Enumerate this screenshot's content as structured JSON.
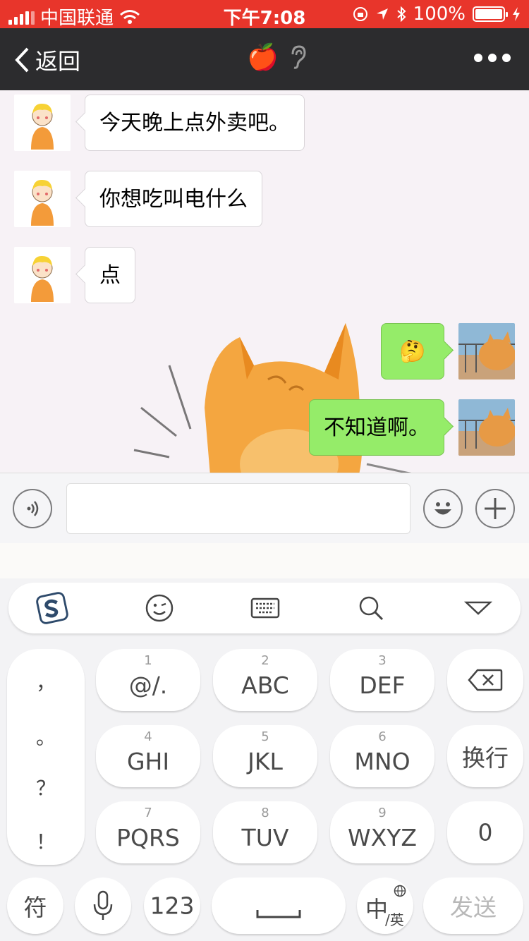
{
  "status_bar": {
    "carrier": "中国联通",
    "time": "下午7:08",
    "battery": "100%",
    "color": "#e8352b"
  },
  "nav": {
    "back_label": "返回",
    "title_emoji": "🍎"
  },
  "messages": [
    {
      "side": "in",
      "text": "今天晚上点外卖吧。"
    },
    {
      "side": "in",
      "text": "你想吃叫电什么"
    },
    {
      "side": "in",
      "text": "点"
    },
    {
      "side": "out",
      "text": "🤔"
    },
    {
      "side": "out",
      "text": "不知道啊。"
    }
  ],
  "input": {
    "placeholder": "",
    "voice_icon": "voice-icon",
    "emoji_icon": "emoji-icon",
    "plus_icon": "plus-icon"
  },
  "keyboard": {
    "toolbar": [
      "sogou-logo-icon",
      "wink-emoji-icon",
      "keyboard-icon",
      "search-icon",
      "collapse-icon"
    ],
    "punctuation": [
      "，",
      "。",
      "？",
      "！"
    ],
    "keys": [
      {
        "num": "1",
        "label": "@/."
      },
      {
        "num": "2",
        "label": "ABC"
      },
      {
        "num": "3",
        "label": "DEF"
      },
      {
        "num": "4",
        "label": "GHI"
      },
      {
        "num": "5",
        "label": "JKL"
      },
      {
        "num": "6",
        "label": "MNO"
      },
      {
        "num": "7",
        "label": "PQRS"
      },
      {
        "num": "8",
        "label": "TUV"
      },
      {
        "num": "9",
        "label": "WXYZ"
      }
    ],
    "newline": "换行",
    "zero": "0",
    "symbols": "符",
    "numeric": "123",
    "lang_main": "中",
    "lang_sub": "/英",
    "send": "发送"
  }
}
